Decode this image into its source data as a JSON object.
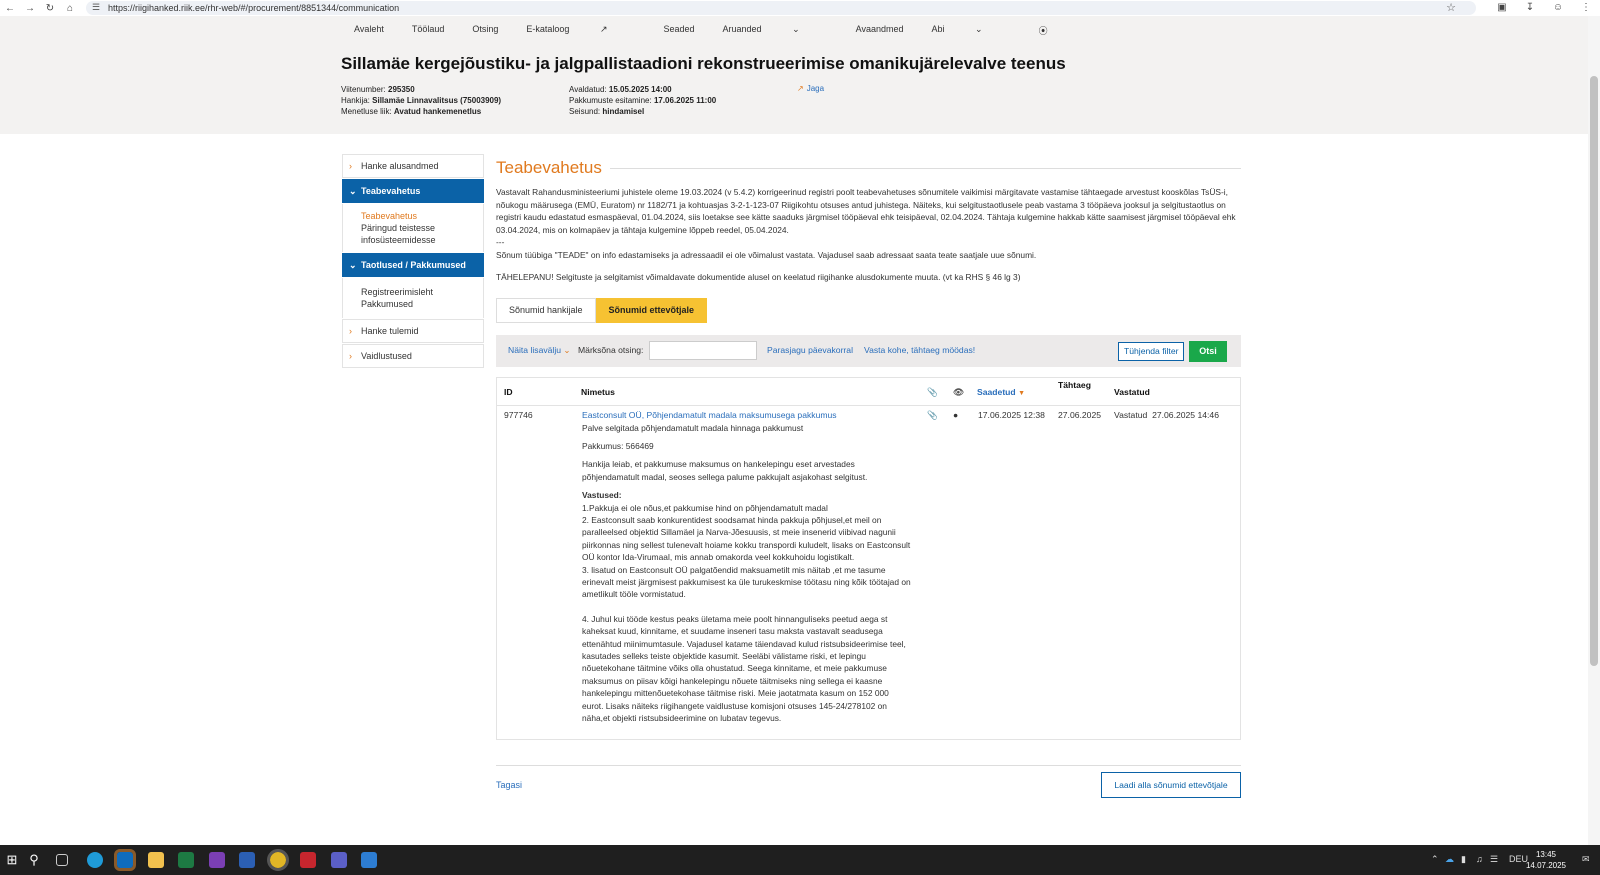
{
  "browser": {
    "url": "https://riigihanked.riik.ee/rhr-web/#/procurement/8851344/communication"
  },
  "topnav": [
    "Avaleht",
    "Töölaud",
    "Otsing",
    "E-kataloog",
    "Seaded",
    "Aruanded",
    "Avaandmed",
    "Abi"
  ],
  "procurement": {
    "title": "Sillamäe kergejõustiku- ja jalgpallistaadioni rekonstrueerimise omanikujärelevalve teenus",
    "ref_label": "Viitenumber:",
    "ref_value": "295350",
    "buyer_label": "Hankija:",
    "buyer_value": "Sillamäe Linnavalitsus (75003909)",
    "procedure_label": "Menetluse liik:",
    "procedure_value": "Avatud hankemenetlus",
    "published_label": "Avaldatud:",
    "published_value": "15.05.2025 14:00",
    "deadline_label": "Pakkumuste esitamine:",
    "deadline_value": "17.06.2025 11:00",
    "status_label": "Seisund:",
    "status_value": "hindamisel",
    "share_label": "Jaga"
  },
  "sidebar": {
    "item1": "Hanke alusandmed",
    "item2": "Teabevahetus",
    "sub2a": "Teabevahetus",
    "sub2b1": "Päringud teistesse",
    "sub2b2": "infosüsteemidesse",
    "item3": "Taotlused / Pakkumused",
    "sub3a": "Registreerimisleht",
    "sub3b": "Pakkumused",
    "item4": "Hanke tulemid",
    "item5": "Vaidlustused"
  },
  "main": {
    "heading": "Teabevahetus",
    "intro1": "Vastavalt Rahandusministeeriumi juhistele oleme 19.03.2024 (v 5.4.2) korrigeerinud registri poolt teabevahetuses sõnumitele vaikimisi märgitavate vastamise tähtaegade arvestust kooskõlas TsÜS-i, nõukogu määrusega (EMÜ, Euratom) nr 1182/71 ja kohtuasjas 3-2-1-123-07 Riigikohtu otsuses antud juhistega. Näiteks, kui selgitustaotlusele peab vastama 3 tööpäeva jooksul ja selgitustaotlus on registri kaudu edastatud esmaspäeval, 01.04.2024, siis loetakse see kätte saaduks järgmisel tööpäeval ehk teisipäeval, 02.04.2024. Tähtaja kulgemine hakkab kätte saamisest järgmisel tööpäeval ehk 03.04.2024, mis on kolmapäev ja tähtaja kulgemine lõppeb reedel, 05.04.2024.",
    "intro_sep": "---",
    "intro2": "Sõnum tüübiga \"TEADE\" on info edastamiseks ja adressaadil ei ole võimalust vastata. Vajadusel saab adressaat saata teate saatjale uue sõnumi.",
    "intro3": "TÄHELEPANU! Selgituste ja selgitamist võimaldavate dokumentide alusel on keelatud riigihanke alusdokumente muuta. (vt ka RHS § 46 lg 3)",
    "tab_buyer": "Sõnumid hankijale",
    "tab_bidders": "Sõnumid ettevõtjale"
  },
  "filter": {
    "more_fields": "Näita lisavälju",
    "keyword_label": "Märksõna otsing:",
    "keyword_value": "",
    "link_daily": "Parasjagu päevakorral",
    "link_overdue": "Vasta kohe, tähtaeg möödas!",
    "clear_label": "Tühjenda filter",
    "search_label": "Otsi"
  },
  "table": {
    "headers": {
      "id": "ID",
      "name": "Nimetus",
      "sent": "Saadetud",
      "deadline": "Tähtaeg",
      "answered": "Vastatud"
    },
    "row": {
      "id": "977746",
      "title": "Eastconsult OÜ, Põhjendamatult madala maksumusega pakkumus",
      "subtitle": "Palve selgitada põhjendamatult madala hinnaga pakkumust",
      "offer": "Pakkumus: 566469",
      "body1": "Hankija leiab, et pakkumuse maksumus on hankelepingu eset arvestades põhjendamatult madal, seoses sellega palume pakkujalt asjakohast selgitust.",
      "answers_heading": "Vastused:",
      "ans1": "1.Pakkuja ei ole nõus,et pakkumise hind on põhjendamatult madal",
      "ans2": "2. Eastconsult saab konkurentidest soodsamat hinda pakkuja põhjusel,et meil on paralleelsed objektid Sillamäel ja Narva-Jõesuusis, st meie insenerid viibivad nagunii piirkonnas ning sellest tulenevalt hoiame kokku transpordi kuludelt, lisaks on Eastconsult OÜ kontor Ida-Virumaal, mis annab omakorda veel kokkuhoidu logistikalt.",
      "ans3": "3. lisatud on Eastconsult OÜ palgatõendid maksuametilt mis näitab ,et me tasume erinevalt meist järgmisest pakkumisest ka üle turukeskmise töötasu ning kõik töötajad on ametlikult tööle vormistatud.",
      "ans4": "4. Juhul kui tööde kestus peaks ületama meie poolt hinnanguliseks peetud aega st kaheksat kuud, kinnitame, et suudame inseneri tasu maksta vastavalt seadusega ettenähtud miinimumtasule. Vajadusel katame täiendavad kulud ristsubsideerimise teel, kasutades selleks teiste objektide kasumit. Seeläbi välistame riski, et lepingu nõuetekohane täitmine võiks olla ohustatud. Seega kinnitame, et meie pakkumuse maksumus on piisav kõigi hankelepingu nõuete täitmiseks ning sellega ei kaasne hankelepingu mittenõuetekohase täitmise riski. Meie jaotatmata kasum on 152 000 eurot. Lisaks näiteks riigihangete vaidlustuse komisjoni otsuses 145-24/278102 on näha,et objekti ristsubsideerimine on lubatav tegevus.",
      "sent": "17.06.2025 12:38",
      "deadline": "27.06.2025",
      "answered_label": "Vastatud",
      "answered_date": "27.06.2025 14:46"
    }
  },
  "footer": {
    "back": "Tagasi",
    "download": "Laadi alla sõnumid ettevõtjale"
  },
  "taskbar": {
    "lang": "DEU",
    "time": "13:45",
    "date": "14.07.2025"
  },
  "colors": {
    "accent_orange": "#e07a1f",
    "nav_blue": "#0b62a7",
    "tab_yellow": "#f6c232",
    "search_green": "#1aa84a"
  }
}
